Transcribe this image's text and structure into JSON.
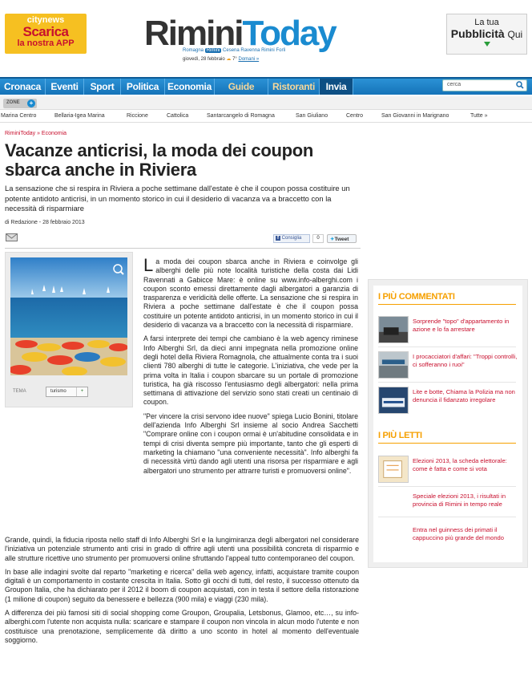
{
  "brand": {
    "citynews": {
      "line1": "citynews",
      "line2": "Scarica",
      "line3": "la nostra APP"
    },
    "logo_part1": "Rimini",
    "logo_part2": "Today",
    "cities": [
      "Romagna",
      "Rimini",
      "Cesena",
      "Ravenna",
      "Rimini",
      "Forlì"
    ],
    "date": "giovedì, 28 febbraio",
    "temp": "7°",
    "tomorrow": "Domani »",
    "ad_line1": "La tua",
    "ad_line2": "Pubblicità",
    "ad_line3": "Qui"
  },
  "nav": {
    "items": [
      {
        "label": "Cronaca"
      },
      {
        "label": "Eventi"
      },
      {
        "label": "Sport"
      },
      {
        "label": "Politica"
      },
      {
        "label": "Economia"
      },
      {
        "label": "Guide"
      },
      {
        "label": "Ristoranti"
      },
      {
        "label": "Invia"
      }
    ],
    "search_placeholder": "cerca"
  },
  "zones": {
    "button": "ZONE",
    "items": [
      "Marina Centro",
      "Bellaria-Igea Marina",
      "Riccione",
      "Cattolica",
      "Santarcangelo di Romagna",
      "San Giuliano",
      "Centro",
      "San Giovanni in Marignano",
      "Tutte »"
    ]
  },
  "article": {
    "breadcrumb": "RiminiToday » Economia",
    "title": "Vacanze anticrisi, la moda dei coupon sbarca anche in Riviera",
    "summary": "La sensazione che si respira in Riviera a poche settimane dall'estate è che il coupon possa costituire un potente antidoto anticrisi, in un momento storico in cui il desiderio di vacanza va a braccetto con la necessità di risparmiare",
    "byline": "di Redazione - 28 febbraio 2013",
    "share_label": "Consiglia",
    "share_count": "0",
    "tweet_label": "Tweet",
    "tag_label": "TEMA",
    "tag_value": "turismo",
    "tag_plus": "+",
    "dropcap": "L",
    "p1": "a moda dei coupon sbarca anche in Riviera e coinvolge gli alberghi delle più note località turistiche della costa dai Lidi Ravennati a Gabicce Mare: è online su www.info-alberghi.com i coupon sconto emessi direttamente dagli albergatori a garanzia di trasparenza e veridicità delle offerte. La sensazione che si respira in Riviera a poche settimane dall'estate è che il coupon possa costituire un potente antidoto anticrisi, in un momento storico in cui il desiderio di vacanza va a braccetto con la necessità di risparmiare.",
    "p2": "A farsi interprete dei tempi che cambiano è la web agency riminese Info Alberghi Srl, da dieci anni impegnata nella promozione online degli hotel della Riviera Romagnola, che attualmente conta tra i suoi clienti 780 alberghi di tutte le categorie. L'iniziativa, che vede per la prima volta in Italia i coupon sbarcare su un portale di promozione turistica, ha già riscosso l'entusiasmo degli albergatori: nella prima settimana di attivazione del servizio sono stati creati un centinaio di coupon.",
    "p3": "\"Per vincere la crisi servono idee nuove\" spiega Lucio Bonini, titolare dell'azienda Info Alberghi Srl insieme al socio Andrea Sacchetti \"Comprare online con i coupon ormai è un'abitudine consolidata e in tempi di crisi diventa sempre più importante, tanto che gli esperti di marketing la chiamano \"una conveniente necessità\". Info alberghi fa di necessità virtù dando agli utenti una risorsa per risparmiare e agli albergatori uno strumento per attrarre turisti e promuoversi online\".",
    "p4": "Grande, quindi, la fiducia riposta nello staff di Info Alberghi Srl e la lungimiranza degli albergatori nel considerare l'iniziativa un potenziale strumento anti crisi in grado di offrire agli utenti una possibilità concreta di risparmio e alle strutture ricettive uno strumento per promuoversi online sfruttando l'appeal tutto contemporaneo del coupon.",
    "p5": "In base alle indagini svolte dal reparto \"marketing e ricerca\" della web agency, infatti, acquistare tramite coupon digitali è un comportamento in costante crescita in Italia. Sotto gli occhi di tutti, del resto, il successo ottenuto da Groupon Italia, che ha dichiarato per il 2012 il boom di coupon acquistati, con in testa il settore della ristorazione (1 milione di coupon) seguito da benessere e bellezza (900 mila) e viaggi (230 mila).",
    "p6": "A differenza dei più famosi siti di social shopping come Groupon, Groupalia, Letsbonus, Glamoo, etc…, su info-alberghi.com l'utente non acquista nulla: scaricare e stampare il coupon non vincola in alcun modo l'utente e non costituisce una prenotazione, semplicemente dà diritto a uno sconto in hotel al momento dell'eventuale soggiorno."
  },
  "sidebar": {
    "commented_title": "I PIÙ COMMENTATI",
    "commented": [
      {
        "text": "Sorprende \"topo\" d'appartamento in azione e lo fa arrestare"
      },
      {
        "text": "I procacciatori d'affari: \"Troppi controlli, ci sofferanno i ruoi\""
      },
      {
        "text": "Lite e botte, Chiama la Polizia ma non denuncia il fidanzato irregolare"
      }
    ],
    "read_title": "I PIÙ LETTI",
    "read": [
      {
        "text": "Elezioni 2013, la scheda elettorale: come è fatta e come si vota"
      },
      {
        "text": "Speciale elezioni 2013, i risultati in provincia di Rimini in tempo reale"
      },
      {
        "text": "Entra nel guinness dei primati il cappuccino più grande del mondo"
      }
    ]
  }
}
